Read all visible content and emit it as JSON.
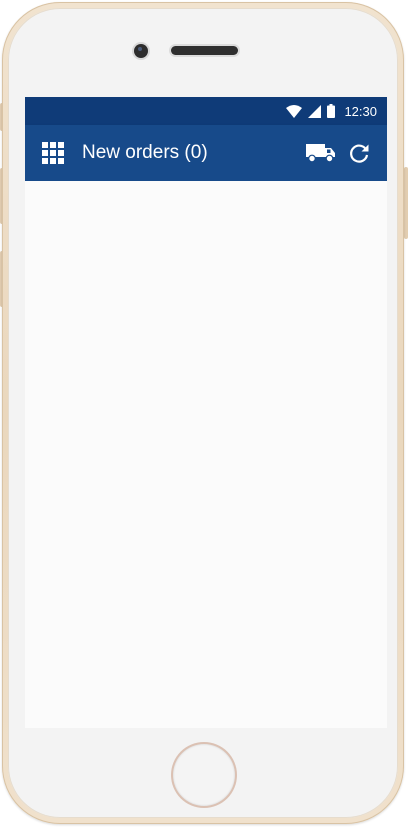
{
  "device": {
    "frame_color": "#ecdcc5",
    "screen_bg": "#fafafa"
  },
  "status_bar": {
    "time": "12:30",
    "icons": [
      "wifi-icon",
      "signal-icon",
      "battery-icon"
    ],
    "bg_color": "#0f3b78"
  },
  "app_bar": {
    "title": "New orders (0)",
    "bg_color": "#174a8a",
    "left_icon": "apps-grid-icon",
    "right_icons": [
      "truck-icon",
      "refresh-icon"
    ]
  }
}
